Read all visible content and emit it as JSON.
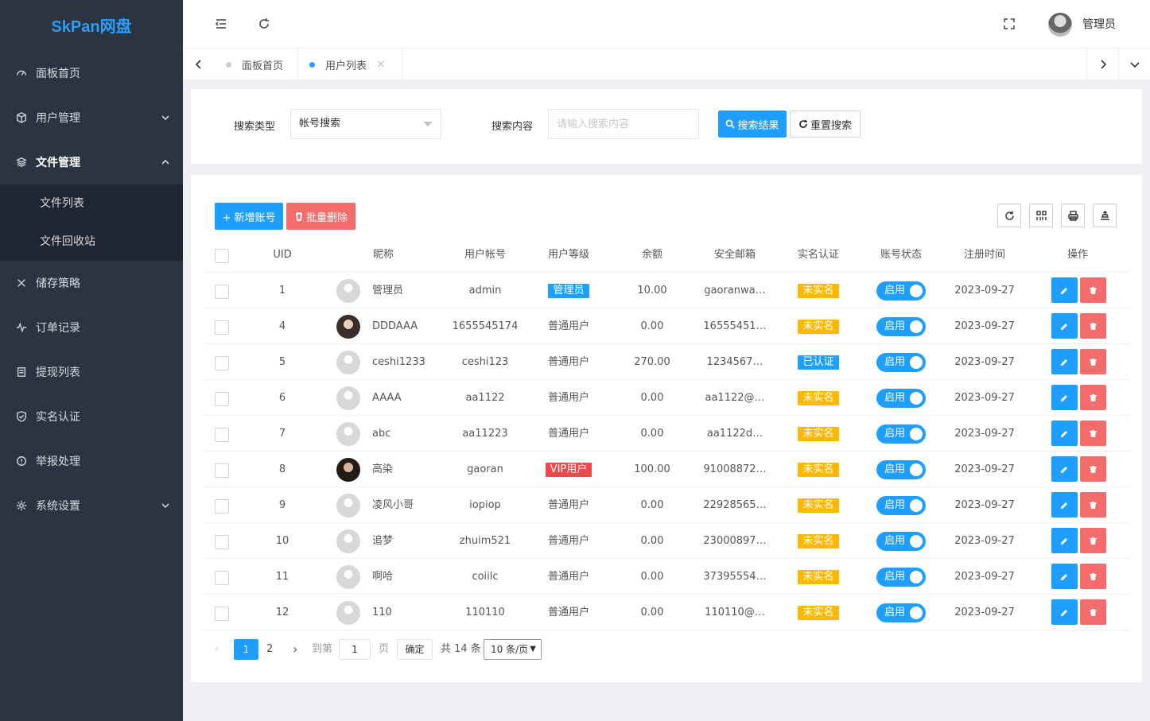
{
  "app": {
    "logo": "SkPan网盘"
  },
  "sidebar": {
    "items": [
      {
        "label": "面板首页",
        "icon": "dashboard-icon"
      },
      {
        "label": "用户管理",
        "icon": "cube-icon"
      },
      {
        "label": "文件管理",
        "icon": "layers-icon"
      },
      {
        "label": "储存策略",
        "icon": "tools-icon"
      },
      {
        "label": "订单记录",
        "icon": "pulse-icon"
      },
      {
        "label": "提现列表",
        "icon": "list-icon"
      },
      {
        "label": "实名认证",
        "icon": "shield-check-icon"
      },
      {
        "label": "举报处理",
        "icon": "info-icon"
      },
      {
        "label": "系统设置",
        "icon": "gear-icon"
      }
    ],
    "submenu": [
      "文件列表",
      "文件回收站"
    ]
  },
  "header": {
    "user_name": "管理员"
  },
  "tabs": [
    {
      "label": "面板首页"
    },
    {
      "label": "用户列表"
    }
  ],
  "search": {
    "type_label": "搜索类型",
    "type_value": "帐号搜索",
    "content_label": "搜索内容",
    "content_placeholder": "请输入搜索内容",
    "search_button": "搜索结果",
    "reset_button": "重置搜索"
  },
  "toolbar": {
    "add_button": "+ 新增账号",
    "batch_delete_button": "批量删除"
  },
  "table": {
    "columns": [
      "UID",
      "昵称",
      "用户帐号",
      "用户等级",
      "余额",
      "安全邮箱",
      "实名认证",
      "账号状态",
      "注册时间",
      "操作"
    ],
    "rows": [
      {
        "uid": "1",
        "nickname": "管理员",
        "account": "admin",
        "level": "管理员",
        "balance": "10.00",
        "email": "gaoranwa…",
        "verify": "未实名",
        "status": "启用",
        "date": "2023-09-27"
      },
      {
        "uid": "4",
        "nickname": "DDDAAA",
        "account": "1655545174",
        "level": "普通用户",
        "balance": "0.00",
        "email": "16555451…",
        "verify": "未实名",
        "status": "启用",
        "date": "2023-09-27"
      },
      {
        "uid": "5",
        "nickname": "ceshi1233",
        "account": "ceshi123",
        "level": "普通用户",
        "balance": "270.00",
        "email": "1234567…",
        "verify": "已认证",
        "status": "启用",
        "date": "2023-09-27"
      },
      {
        "uid": "6",
        "nickname": "AAAA",
        "account": "aa1122",
        "level": "普通用户",
        "balance": "0.00",
        "email": "aa1122@…",
        "verify": "未实名",
        "status": "启用",
        "date": "2023-09-27"
      },
      {
        "uid": "7",
        "nickname": "abc",
        "account": "aa11223",
        "level": "普通用户",
        "balance": "0.00",
        "email": "aa1122d…",
        "verify": "未实名",
        "status": "启用",
        "date": "2023-09-27"
      },
      {
        "uid": "8",
        "nickname": "高染",
        "account": "gaoran",
        "level": "VIP用户",
        "balance": "100.00",
        "email": "91008872…",
        "verify": "未实名",
        "status": "启用",
        "date": "2023-09-27"
      },
      {
        "uid": "9",
        "nickname": "凌风小哥",
        "account": "iopiop",
        "level": "普通用户",
        "balance": "0.00",
        "email": "22928565…",
        "verify": "未实名",
        "status": "启用",
        "date": "2023-09-27"
      },
      {
        "uid": "10",
        "nickname": "追梦",
        "account": "zhuim521",
        "level": "普通用户",
        "balance": "0.00",
        "email": "23000897…",
        "verify": "未实名",
        "status": "启用",
        "date": "2023-09-27"
      },
      {
        "uid": "11",
        "nickname": "啊哈",
        "account": "coiilc",
        "level": "普通用户",
        "balance": "0.00",
        "email": "37395554…",
        "verify": "未实名",
        "status": "启用",
        "date": "2023-09-27"
      },
      {
        "uid": "12",
        "nickname": "110",
        "account": "110110",
        "level": "普通用户",
        "balance": "0.00",
        "email": "110110@…",
        "verify": "未实名",
        "status": "启用",
        "date": "2023-09-27"
      }
    ]
  },
  "pagination": {
    "current": "1",
    "next_page": "2",
    "goto_label": "到第",
    "goto_value": "1",
    "page_unit": "页",
    "confirm": "确定",
    "total": "共 14 条",
    "page_size": "10 条/页"
  },
  "colors": {
    "primary": "#1e9fff",
    "danger": "#f56c6c",
    "warning": "#ffb800",
    "sidebar": "#2b3441"
  }
}
